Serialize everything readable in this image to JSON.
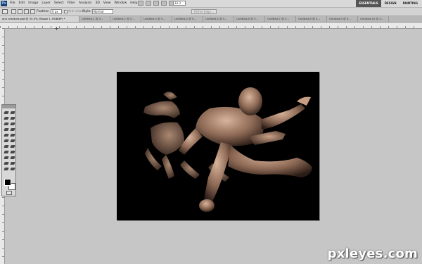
{
  "app": {
    "logo": "Ps"
  },
  "menu": {
    "items": [
      "File",
      "Edit",
      "Image",
      "Layer",
      "Select",
      "Filter",
      "Analysis",
      "3D",
      "View",
      "Window",
      "Help"
    ]
  },
  "zoom": "33.3",
  "workspaces": [
    "ESSENTIALS",
    "DESIGN",
    "PAINTING"
  ],
  "options": {
    "feather_label": "Feather:",
    "feather_value": "0 px",
    "antialias_label": "Anti-alias",
    "style_label": "Style:",
    "style_value": "Normal",
    "refine_edge": "Refine Edge..."
  },
  "tabs": [
    "ann creature.psd @ 33.3% (Shape 1, RGB/8*) *",
    "Untitled-1 @ 5...",
    "Untitled-2 @ 5...",
    "Untitled-3 @ 5...",
    "Untitled-4 @ 5...",
    "Untitled-5 @ 5...",
    "Untitled-6 @ 5...",
    "Untitled-7 @ 5...",
    "Untitled-8 @ 5...",
    "Untitled-9 @ 5...",
    "Untitled-10 @ 5..."
  ],
  "colors": {
    "foreground": "#000000",
    "background": "#ffffff",
    "canvas_bg": "#000000",
    "workspace": "#c6c6c6"
  },
  "watermark": "pxleyes.com"
}
